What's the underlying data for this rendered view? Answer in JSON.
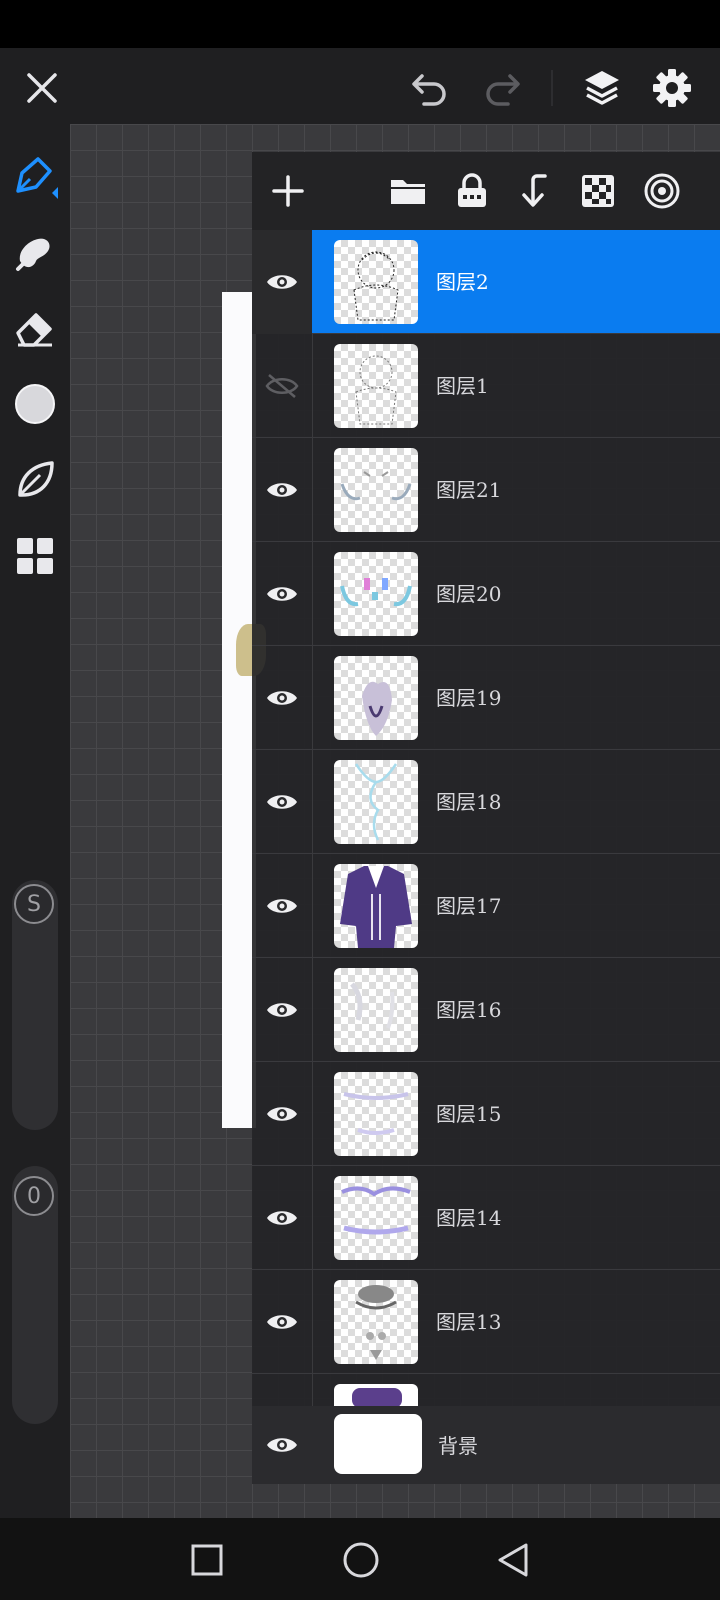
{
  "top_bar": {
    "icons": [
      "close-icon",
      "undo-icon",
      "redo-icon",
      "layers-icon",
      "settings-icon"
    ]
  },
  "left_toolbar": {
    "tools": [
      "brush-tool",
      "smudge-tool",
      "eraser-tool",
      "color-picker",
      "leaf-brush-tool",
      "grid-tool"
    ],
    "size_slider_label": "S",
    "opacity_slider_label": "0"
  },
  "layers_panel": {
    "header_icons": [
      "add-layer-icon",
      "folder-icon",
      "lock-icon",
      "merge-down-icon",
      "alpha-lock-icon",
      "mask-icon"
    ],
    "layers": [
      {
        "name": "图层2",
        "visible": true,
        "selected": true
      },
      {
        "name": "图层1",
        "visible": false,
        "selected": false
      },
      {
        "name": "图层21",
        "visible": true,
        "selected": false
      },
      {
        "name": "图层20",
        "visible": true,
        "selected": false
      },
      {
        "name": "图层19",
        "visible": true,
        "selected": false
      },
      {
        "name": "图层18",
        "visible": true,
        "selected": false
      },
      {
        "name": "图层17",
        "visible": true,
        "selected": false
      },
      {
        "name": "图层16",
        "visible": true,
        "selected": false
      },
      {
        "name": "图层15",
        "visible": true,
        "selected": false
      },
      {
        "name": "图层14",
        "visible": true,
        "selected": false
      },
      {
        "name": "图层13",
        "visible": true,
        "selected": false
      }
    ],
    "background_layer": {
      "name": "背景",
      "visible": true
    }
  },
  "colors": {
    "accent": "#0a7cf0",
    "panel_bg": "#242426",
    "toolbar_bg": "#1f1f21"
  }
}
